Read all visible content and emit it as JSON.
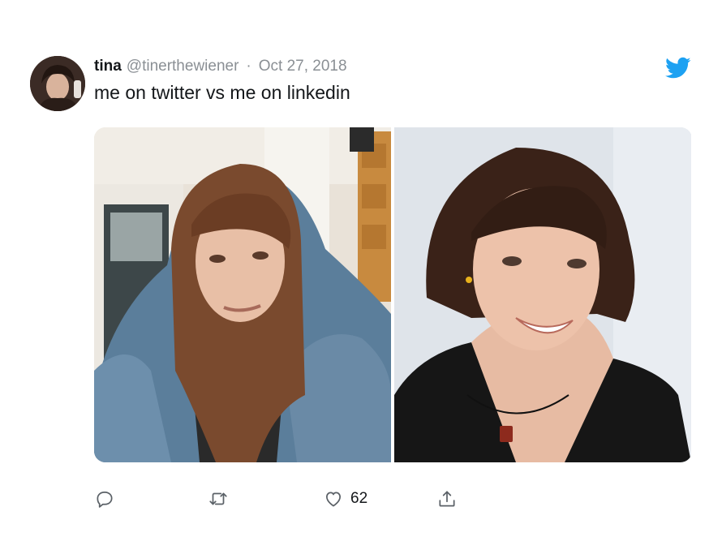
{
  "tweet": {
    "display_name": "tina",
    "handle": "@tinerthewiener",
    "separator": "·",
    "timestamp": "Oct 27, 2018",
    "text": "me on twitter vs me on linkedin"
  },
  "media": [
    {
      "name": "twitter-selfie-photo",
      "alt": "woman in a denim jacket pulled over her head"
    },
    {
      "name": "linkedin-portrait-photo",
      "alt": "woman in a black blazer smiling"
    }
  ],
  "actions": {
    "reply_icon": "reply-icon",
    "retweet_icon": "retweet-icon",
    "like_icon": "heart-icon",
    "like_count": "62",
    "share_icon": "share-icon"
  },
  "colors": {
    "brand": "#1da1f2",
    "text": "#14171a",
    "muted": "#8a8f94"
  }
}
